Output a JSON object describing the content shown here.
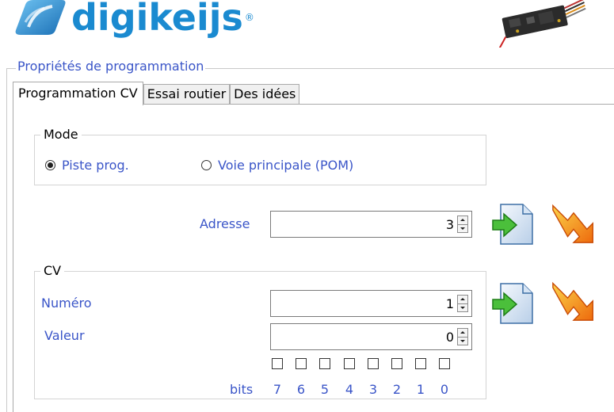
{
  "brand": {
    "name": "digikeijs",
    "registered_mark": "®"
  },
  "group_title": "Propriétés de programmation",
  "tabs": [
    {
      "label": "Programmation CV",
      "active": true
    },
    {
      "label": "Essai routier",
      "active": false
    },
    {
      "label": "Des idées",
      "active": false
    }
  ],
  "mode": {
    "legend": "Mode",
    "options": [
      {
        "label": "Piste prog.",
        "checked": true
      },
      {
        "label": "Voie principale (POM)",
        "checked": false
      }
    ]
  },
  "address": {
    "label": "Adresse",
    "value": "3"
  },
  "cv": {
    "legend": "CV",
    "number_label": "Numéro",
    "number_value": "1",
    "value_label": "Valeur",
    "value_value": "0",
    "bits_label": "bits",
    "bits": [
      "7",
      "6",
      "5",
      "4",
      "3",
      "2",
      "1",
      "0"
    ]
  },
  "icons": {
    "read": "read-icon",
    "write": "write-icon"
  },
  "colors": {
    "brand_blue": "#1a8ad0",
    "label_blue": "#3a55c8",
    "arrow_orange": "#f59a1e"
  }
}
